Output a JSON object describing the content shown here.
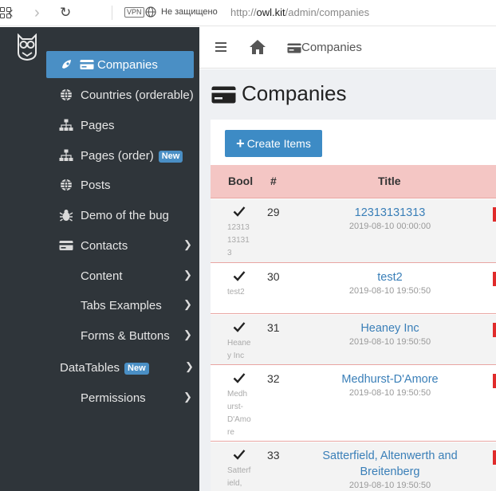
{
  "browser": {
    "vpn": "VPN",
    "insecure": "Не защищено",
    "url_prefix": "http://",
    "url_host": "owl.kit",
    "url_path": "/admin/companies"
  },
  "sidebar": {
    "items": [
      {
        "label": "Companies",
        "icon": "credit-card-icon",
        "active": true
      },
      {
        "label": "Countries (orderable)",
        "icon": "globe-icon"
      },
      {
        "label": "Pages",
        "icon": "sitemap-icon"
      },
      {
        "label": "Pages (order)",
        "icon": "sitemap-icon",
        "badge": "New"
      },
      {
        "label": "Posts",
        "icon": "globe-icon"
      },
      {
        "label": "Demo of the bug",
        "icon": "bug-icon"
      },
      {
        "label": "Contacts",
        "icon": "credit-card-icon",
        "chevron": true
      },
      {
        "label": "Content",
        "chevron": true
      },
      {
        "label": "Tabs Examples",
        "chevron": true
      },
      {
        "label": "Forms & Buttons",
        "chevron": true
      },
      {
        "label": "DataTables",
        "badge": "New",
        "chevron": true
      },
      {
        "label": "Permissions",
        "chevron": true
      }
    ]
  },
  "header": {
    "breadcrumb": "Companies"
  },
  "main": {
    "title": "Companies",
    "create_button": "Create Items",
    "table": {
      "columns": [
        "Bool",
        "#",
        "Title"
      ],
      "rows": [
        {
          "bool_sub": "12313131313",
          "id": "29",
          "title": "12313131313",
          "date": "2019-08-10 00:00:00"
        },
        {
          "bool_sub": "test2",
          "id": "30",
          "title": "test2",
          "date": "2019-08-10 19:50:50"
        },
        {
          "bool_sub": "Heaney Inc",
          "id": "31",
          "title": "Heaney Inc",
          "date": "2019-08-10 19:50:50"
        },
        {
          "bool_sub": "Medhurst-D'Amore",
          "id": "32",
          "title": "Medhurst-D'Amore",
          "date": "2019-08-10 19:50:50"
        },
        {
          "bool_sub": "Satterfield,",
          "id": "33",
          "title": "Satterfield, Altenwerth and Breitenberg",
          "date": "2019-08-10 19:50:50"
        }
      ]
    }
  },
  "colors": {
    "sidebar_bg": "#2f353a",
    "accent": "#4a8fc5",
    "table_header": "#f4c6c4",
    "link": "#3a7fb8",
    "status_red": "#e02b2b"
  }
}
